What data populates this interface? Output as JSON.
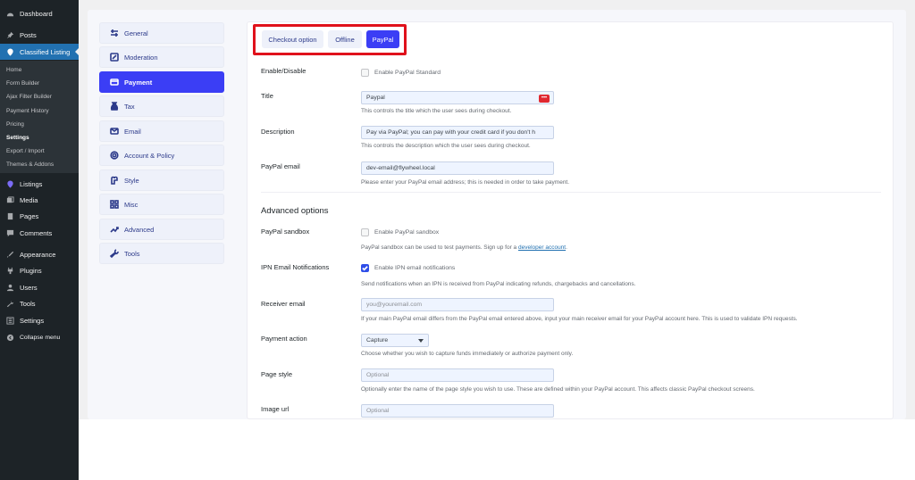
{
  "wp_menu": {
    "dashboard": "Dashboard",
    "posts": "Posts",
    "classified_listing": "Classified Listing",
    "sub": [
      "Home",
      "Form Builder",
      "Ajax Filter Builder",
      "Payment History",
      "Pricing",
      "Settings",
      "Export / Import",
      "Themes & Addons"
    ],
    "listings": "Listings",
    "media": "Media",
    "pages": "Pages",
    "comments": "Comments",
    "appearance": "Appearance",
    "plugins": "Plugins",
    "users": "Users",
    "tools": "Tools",
    "settings": "Settings",
    "collapse": "Collapse menu"
  },
  "settings_menu": [
    "General",
    "Moderation",
    "Payment",
    "Tax",
    "Email",
    "Account & Policy",
    "Style",
    "Misc",
    "Advanced",
    "Tools"
  ],
  "tabs": [
    "Checkout option",
    "Offline",
    "PayPal"
  ],
  "form": {
    "enable": {
      "label": "Enable/Disable",
      "checkbox": "Enable PayPal Standard"
    },
    "title": {
      "label": "Title",
      "value": "Paypal",
      "help": "This controls the title which the user sees during checkout."
    },
    "description": {
      "label": "Description",
      "value": "Pay via PayPal; you can pay with your credit card if you don't h",
      "help": "This controls the description which the user sees during checkout."
    },
    "paypal_email": {
      "label": "PayPal email",
      "value": "dev-email@flywheel.local",
      "help": "Please enter your PayPal email address; this is needed in order to take payment."
    },
    "advanced_title": "Advanced options",
    "sandbox": {
      "label": "PayPal sandbox",
      "checkbox": "Enable PayPal sandbox",
      "help": "PayPal sandbox can be used to test payments. Sign up for a",
      "link": "developer account",
      "help_end": "."
    },
    "ipn": {
      "label": "IPN Email Notifications",
      "checkbox": "Enable IPN email notifications",
      "help": "Send notifications when an IPN is received from PayPal indicating refunds, chargebacks and cancellations."
    },
    "receiver": {
      "label": "Receiver email",
      "placeholder": "you@youremail.com",
      "help": "If your main PayPal email differs from the PayPal email entered above, input your main receiver email for your PayPal account here. This is used to validate IPN requests."
    },
    "payment_action": {
      "label": "Payment action",
      "value": "Capture",
      "help": "Choose whether you wish to capture funds immediately or authorize payment only."
    },
    "page_style": {
      "label": "Page style",
      "placeholder": "Optional",
      "help": "Optionally enter the name of the page style you wish to use. These are defined within your PayPal account. This affects classic PayPal checkout screens."
    },
    "image_url": {
      "label": "Image url",
      "placeholder": "Optional"
    }
  },
  "colors": {
    "accent": "#3b3ef5",
    "highlight": "#e0111b",
    "wp_sidebar": "#1d2327",
    "wp_active": "#2271b1"
  }
}
